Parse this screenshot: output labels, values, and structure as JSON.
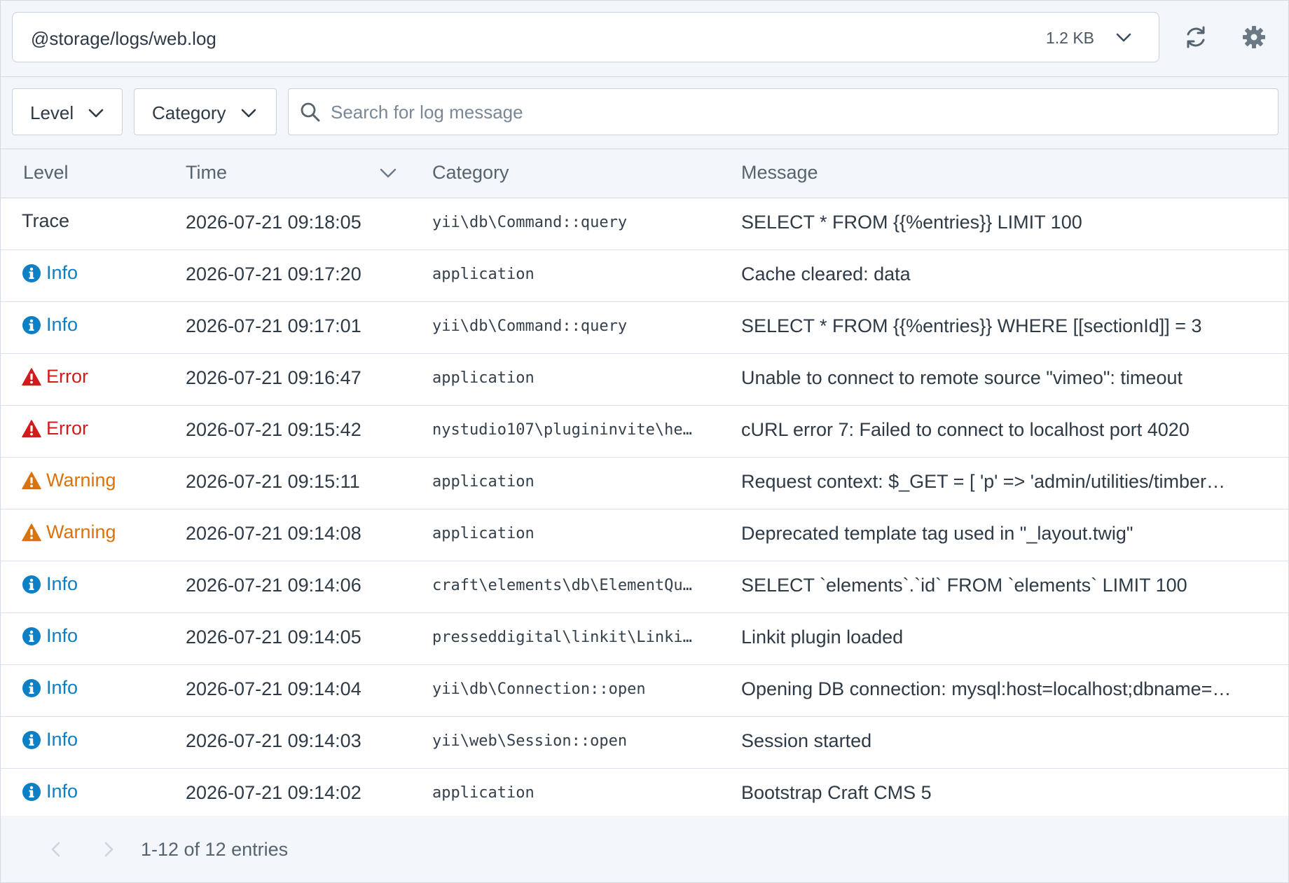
{
  "file": {
    "path": "@storage/logs/web.log",
    "size": "1.2 KB"
  },
  "filters": {
    "level_label": "Level",
    "category_label": "Category",
    "search_placeholder": "Search for log message",
    "search_value": ""
  },
  "table": {
    "headers": {
      "level": "Level",
      "time": "Time",
      "category": "Category",
      "message": "Message"
    },
    "rows": [
      {
        "level": "Trace",
        "level_type": "trace",
        "time": "2026-07-21 09:18:05",
        "category": "yii\\db\\Command::query",
        "message": "SELECT * FROM {{%entries}} LIMIT 100"
      },
      {
        "level": "Info",
        "level_type": "info",
        "time": "2026-07-21 09:17:20",
        "category": "application",
        "message": "Cache cleared: data"
      },
      {
        "level": "Info",
        "level_type": "info",
        "time": "2026-07-21 09:17:01",
        "category": "yii\\db\\Command::query",
        "message": "SELECT * FROM {{%entries}} WHERE [[sectionId]] = 3"
      },
      {
        "level": "Error",
        "level_type": "error",
        "time": "2026-07-21 09:16:47",
        "category": "application",
        "message": "Unable to connect to remote source \"vimeo\": timeout"
      },
      {
        "level": "Error",
        "level_type": "error",
        "time": "2026-07-21 09:15:42",
        "category": "nystudio107\\plugininvite\\he…",
        "message": "cURL error 7: Failed to connect to localhost port 4020"
      },
      {
        "level": "Warning",
        "level_type": "warning",
        "time": "2026-07-21 09:15:11",
        "category": "application",
        "message": "Request context: $_GET = [ 'p' => 'admin/utilities/timber…"
      },
      {
        "level": "Warning",
        "level_type": "warning",
        "time": "2026-07-21 09:14:08",
        "category": "application",
        "message": "Deprecated template tag used in \"_layout.twig\""
      },
      {
        "level": "Info",
        "level_type": "info",
        "time": "2026-07-21 09:14:06",
        "category": "craft\\elements\\db\\ElementQu…",
        "message": "SELECT `elements`.`id` FROM `elements` LIMIT 100"
      },
      {
        "level": "Info",
        "level_type": "info",
        "time": "2026-07-21 09:14:05",
        "category": "presseddigital\\linkit\\Linki…",
        "message": "Linkit plugin loaded"
      },
      {
        "level": "Info",
        "level_type": "info",
        "time": "2026-07-21 09:14:04",
        "category": "yii\\db\\Connection::open",
        "message": "Opening DB connection: mysql:host=localhost;dbname=…"
      },
      {
        "level": "Info",
        "level_type": "info",
        "time": "2026-07-21 09:14:03",
        "category": "yii\\web\\Session::open",
        "message": "Session started"
      },
      {
        "level": "Info",
        "level_type": "info",
        "time": "2026-07-21 09:14:02",
        "category": "application",
        "message": "Bootstrap Craft CMS 5"
      }
    ]
  },
  "pagination": {
    "summary": "1-12 of 12 entries"
  },
  "icons": {
    "refresh": "refresh-icon",
    "settings": "gear-icon",
    "search": "search-icon",
    "info": "info-icon",
    "error": "alert-triangle-icon",
    "warning": "alert-triangle-icon"
  },
  "colors": {
    "info": "#0d7fc4",
    "error": "#d21c1c",
    "warning": "#d9730d",
    "trace": "#2e3a46"
  }
}
